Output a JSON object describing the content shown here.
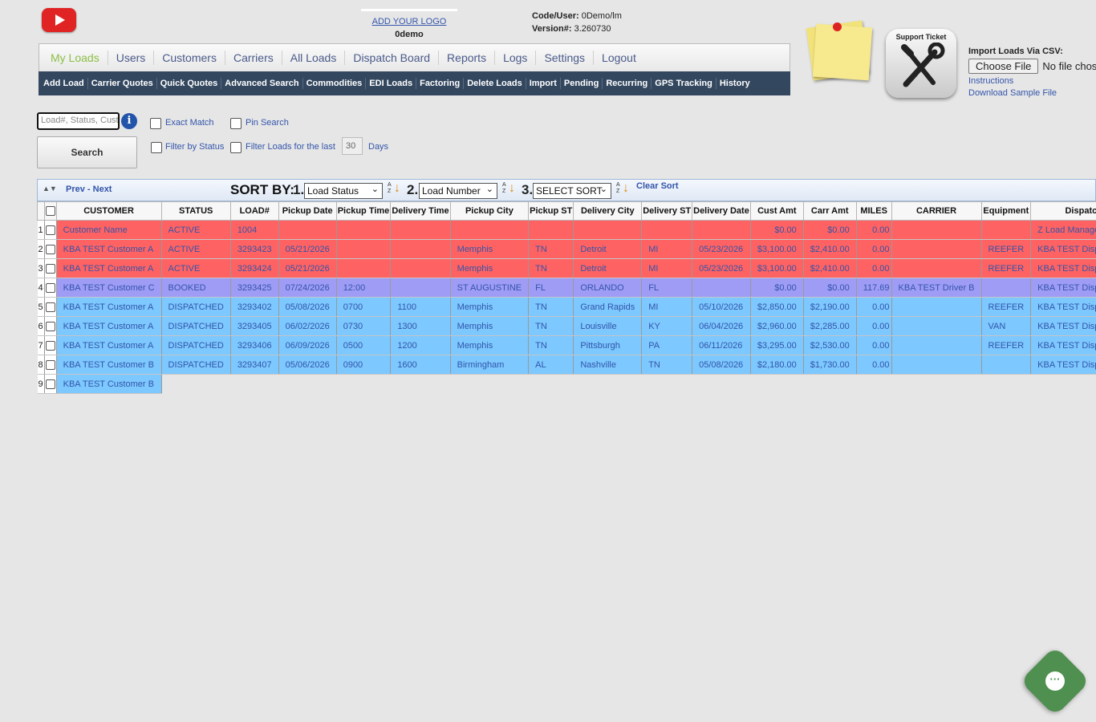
{
  "header": {
    "add_logo": "ADD YOUR LOGO",
    "username": "0demo",
    "code_user_label": "Code/User:",
    "code_user_value": "0Demo/lm",
    "version_label": "Version#:",
    "version_value": "3.260730",
    "brand_color": "#e02424"
  },
  "nav": {
    "tabs": [
      "My Loads",
      "Users",
      "Customers",
      "Carriers",
      "All Loads",
      "Dispatch Board",
      "Reports",
      "Logs",
      "Settings",
      "Logout"
    ],
    "active": "My Loads",
    "sub_items": [
      "Add Load",
      "Carrier Quotes",
      "Quick Quotes",
      "Advanced Search",
      "Commodities",
      "EDI Loads",
      "Factoring",
      "Delete Loads",
      "Import",
      "Pending",
      "Recurring",
      "GPS Tracking",
      "History"
    ]
  },
  "support": {
    "label": "Support Ticket",
    "icon": "wrench-screwdriver-icon"
  },
  "csv": {
    "title": "Import Loads Via CSV:",
    "choose_label": "Choose File",
    "no_file": "No file chos",
    "instructions": "Instructions",
    "sample": "Download Sample File"
  },
  "search": {
    "placeholder": "Load#, Status, Cust",
    "button": "Search",
    "exact_match": "Exact Match",
    "pin_search": "Pin Search",
    "filter_status": "Filter by Status",
    "filter_loads": "Filter Loads for the last",
    "days_value": "30",
    "days_label": "Days"
  },
  "grid": {
    "prev_next": "Prev - Next",
    "sort_by": "SORT BY:",
    "sort1_num": "1.",
    "sort1": "Load Status",
    "sort2_num": "2.",
    "sort2": "Load Number",
    "sort3_num": "3.",
    "sort3": "SELECT SORT",
    "clear_sort": "Clear Sort",
    "columns": [
      "CUSTOMER",
      "STATUS",
      "LOAD#",
      "Pickup Date",
      "Pickup Time",
      "Delivery Time",
      "Pickup City",
      "Pickup ST",
      "Delivery City",
      "Delivery ST",
      "Delivery Date",
      "Cust Amt",
      "Carr Amt",
      "MILES",
      "CARRIER",
      "Equipment",
      "Dispatcher"
    ],
    "rows": [
      {
        "n": "1",
        "color": "red",
        "cells": [
          "Customer Name",
          "ACTIVE",
          "1004",
          "",
          "",
          "",
          "",
          "",
          "",
          "",
          "",
          "$0.00",
          "$0.00",
          "0.00",
          "",
          "",
          "Z Load Manager Support"
        ]
      },
      {
        "n": "2",
        "color": "red",
        "cells": [
          "KBA TEST Customer A",
          "ACTIVE",
          "3293423",
          "05/21/2026",
          "",
          "",
          "Memphis",
          "TN",
          "Detroit",
          "MI",
          "05/23/2026",
          "$3,100.00",
          "$2,410.00",
          "0.00",
          "",
          "REEFER",
          "KBA TEST Dispatcherous"
        ]
      },
      {
        "n": "3",
        "color": "red",
        "cells": [
          "KBA TEST Customer A",
          "ACTIVE",
          "3293424",
          "05/21/2026",
          "",
          "",
          "Memphis",
          "TN",
          "Detroit",
          "MI",
          "05/23/2026",
          "$3,100.00",
          "$2,410.00",
          "0.00",
          "",
          "REEFER",
          "KBA TEST Dispatcherous"
        ]
      },
      {
        "n": "4",
        "color": "purple",
        "cells": [
          "KBA TEST Customer C",
          "BOOKED",
          "3293425",
          "07/24/2026",
          "12:00",
          "",
          "ST AUGUSTINE",
          "FL",
          "ORLANDO",
          "FL",
          "",
          "$0.00",
          "$0.00",
          "117.69",
          "KBA TEST Driver B",
          "",
          "KBA TEST Dispatcher"
        ]
      },
      {
        "n": "5",
        "color": "blue",
        "cells": [
          "KBA TEST Customer A",
          "DISPATCHED",
          "3293402",
          "05/08/2026",
          "0700",
          "1100",
          "Memphis",
          "TN",
          "Grand Rapids",
          "MI",
          "05/10/2026",
          "$2,850.00",
          "$2,190.00",
          "0.00",
          "",
          "REEFER",
          "KBA TEST Dispatcherous"
        ]
      },
      {
        "n": "6",
        "color": "blue",
        "cells": [
          "KBA TEST Customer A",
          "DISPATCHED",
          "3293405",
          "06/02/2026",
          "0730",
          "1300",
          "Memphis",
          "TN",
          "Louisville",
          "KY",
          "06/04/2026",
          "$2,960.00",
          "$2,285.00",
          "0.00",
          "",
          "VAN",
          "KBA TEST Dispatcherous"
        ]
      },
      {
        "n": "7",
        "color": "blue",
        "cells": [
          "KBA TEST Customer A",
          "DISPATCHED",
          "3293406",
          "06/09/2026",
          "0500",
          "1200",
          "Memphis",
          "TN",
          "Pittsburgh",
          "PA",
          "06/11/2026",
          "$3,295.00",
          "$2,530.00",
          "0.00",
          "",
          "REEFER",
          "KBA TEST Dispatcherous"
        ]
      },
      {
        "n": "8",
        "color": "blue",
        "cells": [
          "KBA TEST Customer B",
          "DISPATCHED",
          "3293407",
          "05/06/2026",
          "0900",
          "1600",
          "Birmingham",
          "AL",
          "Nashville",
          "TN",
          "05/08/2026",
          "$2,180.00",
          "$1,730.00",
          "0.00",
          "",
          "",
          "KBA TEST Dispatcherous"
        ]
      },
      {
        "n": "9",
        "color": "blue",
        "cells": [
          "KBA TEST Customer B"
        ]
      }
    ]
  },
  "colors": {
    "active_row": "#ff6262",
    "booked_row": "#9f9cf6",
    "dispatched_row": "#7cc8ff",
    "subnav_bg": "#33475f",
    "active_tab": "#8cbf45"
  }
}
